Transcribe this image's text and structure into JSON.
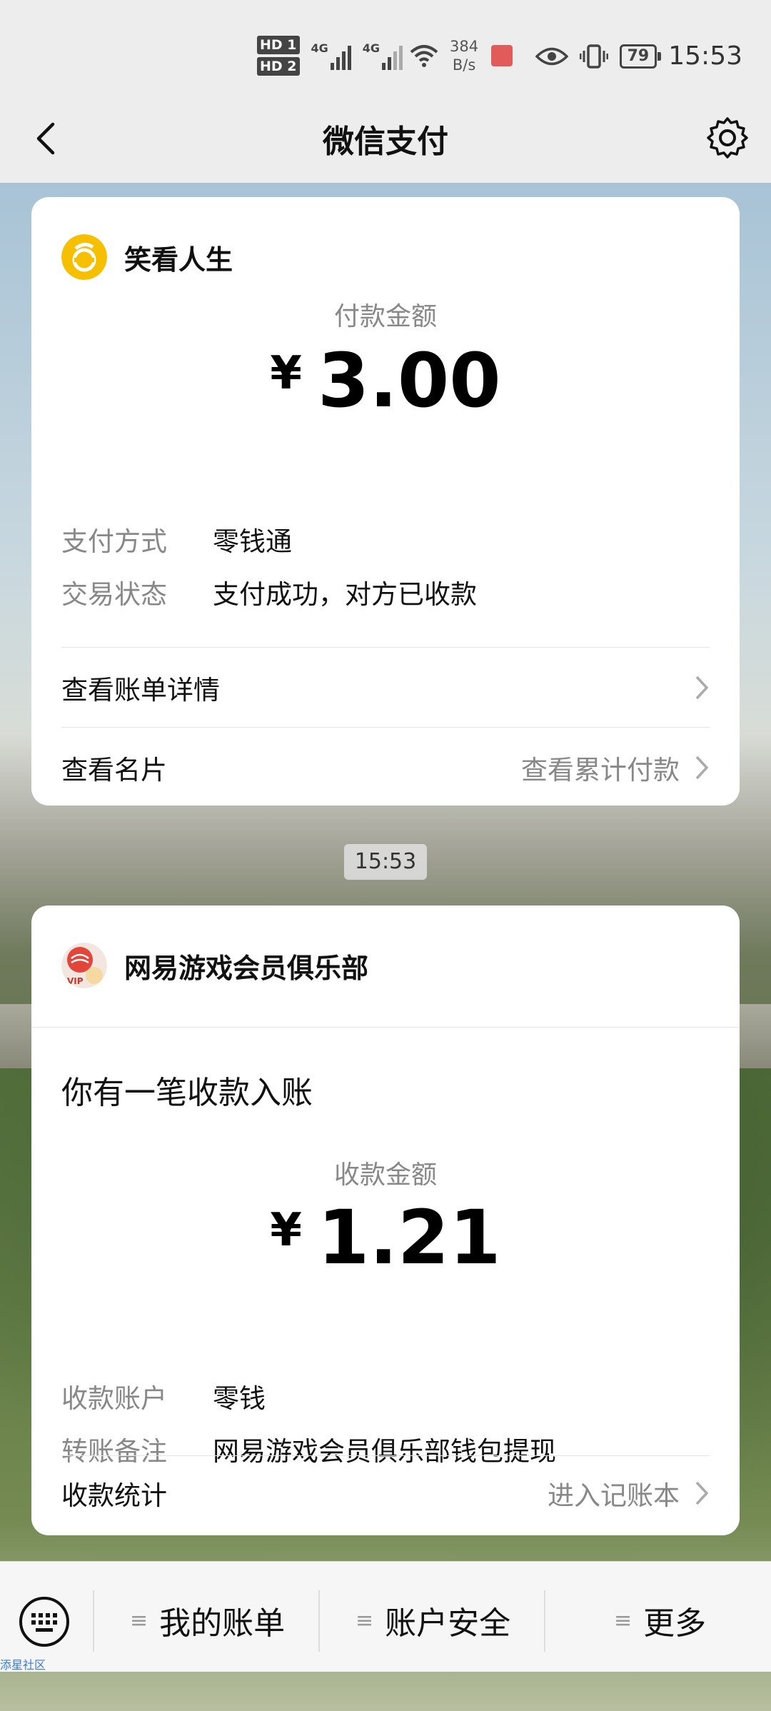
{
  "status_bar": {
    "hd1": "HD 1",
    "hd2": "HD 2",
    "net1": "4G",
    "net2": "4G",
    "speed_value": "384",
    "speed_unit": "B/s",
    "battery": "79",
    "time": "15:53"
  },
  "nav": {
    "title": "微信支付"
  },
  "payment_card": {
    "merchant": "笑看人生",
    "amount_label": "付款金额",
    "currency": "¥",
    "amount": "3.00",
    "rows": [
      {
        "key": "支付方式",
        "value": "零钱通"
      },
      {
        "key": "交易状态",
        "value": "支付成功，对方已收款"
      }
    ],
    "bill_detail": "查看账单详情",
    "card_label": "查看名片",
    "cumulative": "查看累计付款"
  },
  "time_pill": "15:53",
  "income_card": {
    "merchant": "网易游戏会员俱乐部",
    "notice": "你有一笔收款入账",
    "amount_label": "收款金额",
    "currency": "¥",
    "amount": "1.21",
    "rows": [
      {
        "key": "收款账户",
        "value": "零钱"
      },
      {
        "key": "转账备注",
        "value": "网易游戏会员俱乐部钱包提现"
      }
    ],
    "stats_label": "收款统计",
    "ledger": "进入记账本"
  },
  "bottom_bar": {
    "tabs": [
      {
        "label": "我的账单"
      },
      {
        "label": "账户安全"
      },
      {
        "label": "更多"
      }
    ]
  },
  "watermark": "添星社区",
  "icons": [
    "back-arrow-icon",
    "gear-icon",
    "keyboard-icon",
    "chevron-right-icon",
    "menu-lines-icon"
  ],
  "colors": {
    "background": "#ededed",
    "card": "#ffffff",
    "merchant_avatar": "#f6c000"
  }
}
